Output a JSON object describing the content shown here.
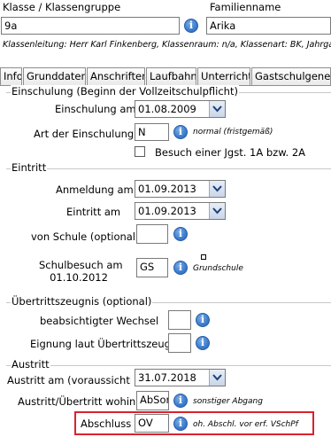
{
  "header": {
    "class_label": "Klasse / Klassengruppe",
    "class_value": "9a",
    "family_label": "Familienname",
    "family_value": "Arika",
    "info_text": "Klassenleitung: Herr Karl Finkenberg, Klassenraum: n/a, Klassenart: BK, Jahrgang"
  },
  "tabs": [
    "Info",
    "Grunddaten",
    "Anschriften",
    "Laufbahn",
    "Unterricht",
    "Gastschulgenehm"
  ],
  "einschulung": {
    "title": "Einschulung (Beginn der Vollzeitschulpflicht)",
    "date_label": "Einschulung am",
    "date_value": "01.08.2009",
    "art_label": "Art der Einschulung",
    "art_value": "N",
    "art_note": "normal (fristgemäß)",
    "checkbox_label": "Besuch einer Jgst. 1A bzw. 2A"
  },
  "eintritt": {
    "title": "Eintritt",
    "anmeldung_label": "Anmeldung am",
    "anmeldung_value": "01.09.2013",
    "eintritt_label": "Eintritt am",
    "eintritt_value": "01.09.2013",
    "von_schule_label": "von Schule (optional)",
    "von_schule_value": "",
    "schulbesuch_label_1": "Schulbesuch am",
    "schulbesuch_label_2": "01.10.2012",
    "schulbesuch_value": "GS",
    "schulbesuch_note": "Grundschule"
  },
  "uebertritt": {
    "title": "Übertrittszeugnis (optional)",
    "wechsel_label": "beabsichtigter Wechsel",
    "wechsel_value": "",
    "eignung_label": "Eignung laut Übertrittszeugnis",
    "eignung_value": ""
  },
  "austritt": {
    "title": "Austritt",
    "date_label": "Austritt am (voraussichtli...",
    "date_value": "31.07.2018",
    "wohin_label": "Austritt/Übertritt wohin",
    "wohin_value": "AbSon",
    "wohin_note": "sonstiger Abgang",
    "abschluss_label": "Abschluss",
    "abschluss_value": "OV",
    "abschluss_note": "oh. Abschl. vor erf. VSchPf"
  },
  "colors": {
    "highlight": "#d9232d",
    "info_icon": "#3f7fcf"
  },
  "icons": {
    "info": "info-icon",
    "dropdown": "chevron-down-icon"
  }
}
